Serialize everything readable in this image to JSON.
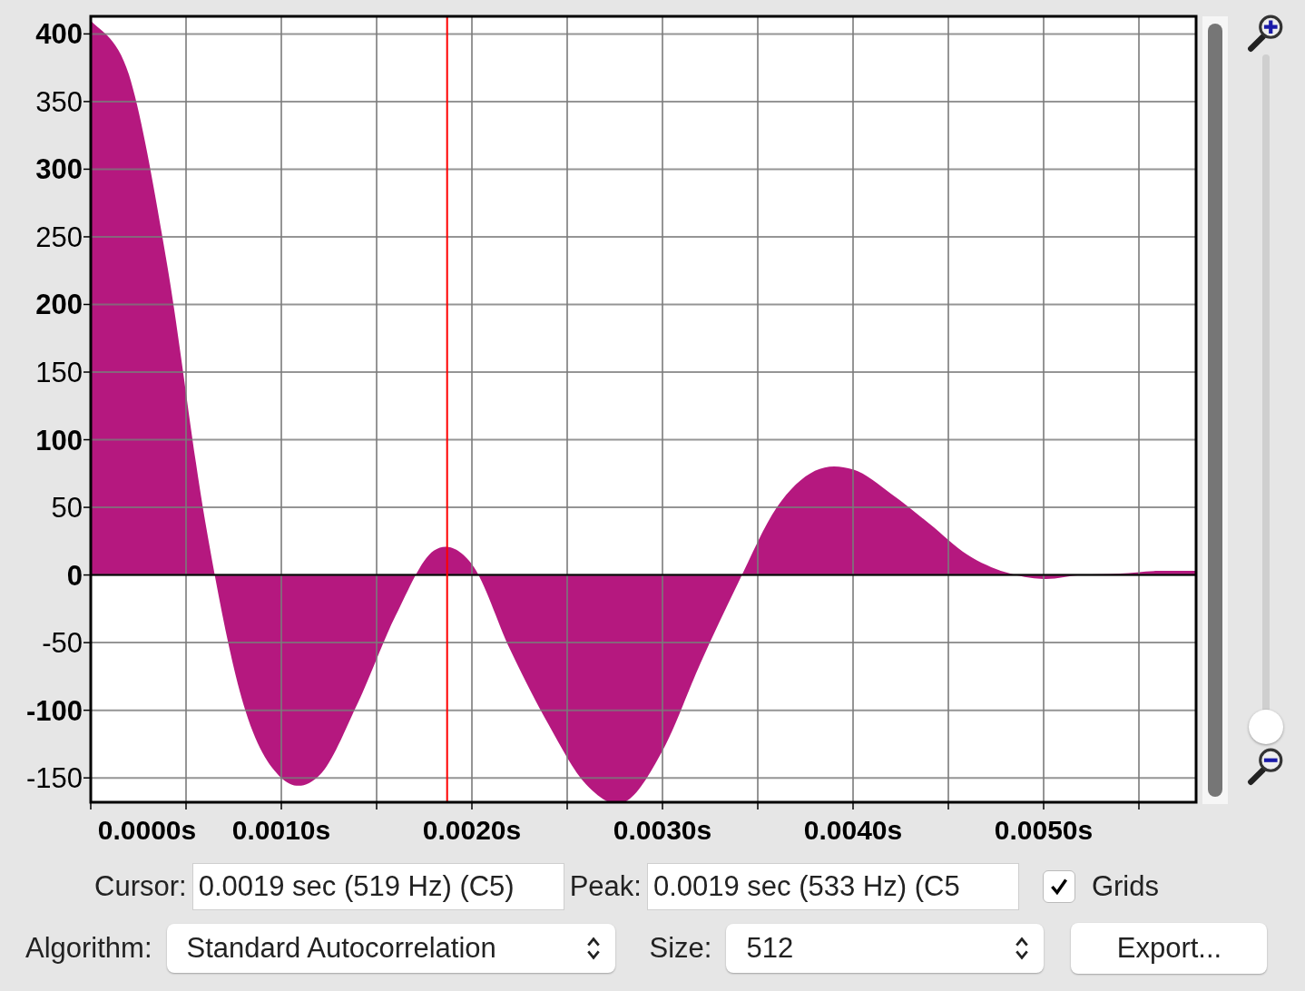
{
  "chart_data": {
    "type": "area",
    "x": [
      0,
      0.0002,
      0.0004,
      0.0006,
      0.0008,
      0.001,
      0.0012,
      0.0014,
      0.0016,
      0.0018,
      0.002,
      0.0022,
      0.0024,
      0.0026,
      0.0028,
      0.003,
      0.0032,
      0.0034,
      0.0036,
      0.0038,
      0.004,
      0.0042,
      0.0044,
      0.0046,
      0.0048,
      0.005,
      0.0052,
      0.0054,
      0.0056,
      0.0058
    ],
    "series": [
      {
        "color": "#b5187f",
        "values": [
          410,
          370,
          230,
          40,
          -95,
          -150,
          -148,
          -95,
          -30,
          18,
          8,
          -55,
          -110,
          -155,
          -168,
          -130,
          -65,
          -5,
          50,
          77,
          78,
          60,
          38,
          15,
          2,
          -3,
          0,
          1,
          3,
          3
        ]
      }
    ],
    "xlim": [
      0,
      0.0058
    ],
    "ylim": [
      -168,
      413
    ],
    "xticks": [
      {
        "value": 0,
        "label": "0.0000s"
      },
      {
        "value": 0.001,
        "label": "0.0010s"
      },
      {
        "value": 0.002,
        "label": "0.0020s"
      },
      {
        "value": 0.003,
        "label": "0.0030s"
      },
      {
        "value": 0.004,
        "label": "0.0040s"
      },
      {
        "value": 0.005,
        "label": "0.0050s"
      }
    ],
    "yticks": [
      400,
      350,
      300,
      250,
      200,
      150,
      100,
      50,
      0,
      -50,
      -100,
      -150
    ],
    "grid": true,
    "ref_lines": [
      {
        "axis": "x",
        "value": 0.00187,
        "color": "#ff0000"
      }
    ]
  },
  "zoom_slider": {
    "level": 0
  },
  "cursor": {
    "label": "Cursor:",
    "value": "0.0019 sec (519 Hz) (C5)"
  },
  "peak": {
    "label": "Peak:",
    "value": "0.0019 sec (533 Hz) (C5"
  },
  "grids": {
    "label": "Grids",
    "checked": true
  },
  "algorithm": {
    "label": "Algorithm:",
    "value": "Standard Autocorrelation"
  },
  "size": {
    "label": "Size:",
    "value": "512"
  },
  "export_button": "Export..."
}
